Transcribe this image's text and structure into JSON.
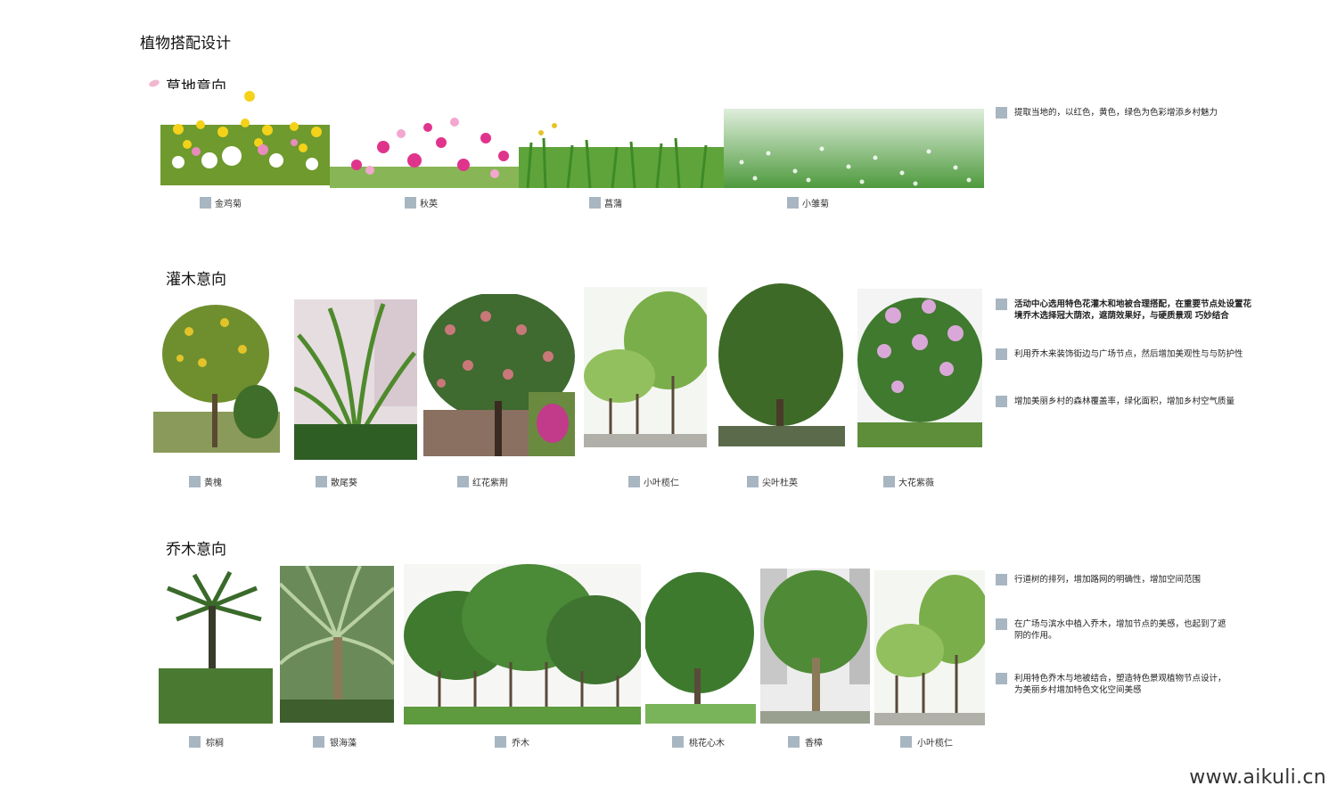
{
  "page": {
    "title": "植物搭配设计",
    "watermark": "www.aikuli.cn"
  },
  "grass": {
    "title": "草地意向",
    "items": [
      "金鸡菊",
      "秋英",
      "菖蒲",
      "小雏菊"
    ],
    "notes": [
      "提取当地的，以红色，黄色，绿色为色彩增添乡村魅力"
    ]
  },
  "shrub": {
    "title": "灌木意向",
    "items": [
      "黄槐",
      "散尾葵",
      "红花紫荆",
      "小叶榄仁",
      "尖叶杜英",
      "大花紫薇"
    ],
    "notes": [
      "活动中心选用特色花灌木和地被合理搭配，在重要节点处设置花境乔木选择冠大荫浓，遮荫效果好，与硬质景观 巧妙结合",
      "利用乔木来装饰街边与广场节点，然后增加美观性与与防护性",
      "增加美丽乡村的森林覆盖率，绿化面积，增加乡村空气质量"
    ]
  },
  "tree": {
    "title": "乔木意向",
    "items": [
      "棕榈",
      "银海藻",
      "乔木",
      "桃花心木",
      "香樟",
      "小叶榄仁"
    ],
    "notes": [
      "行道树的排列，增加路网的明确性，增加空间范围",
      "在广场与滨水中植入乔木，增加节点的美感，也起到了遮阴的作用。",
      "利用特色乔木与地被结合，塑造特色景观植物节点设计，为美丽乡村增加特色文化空间美感"
    ]
  },
  "colors": {
    "caption_square": "#a8b6c1",
    "foliage": "#4f8a34",
    "sky": "#f3f6f2"
  }
}
